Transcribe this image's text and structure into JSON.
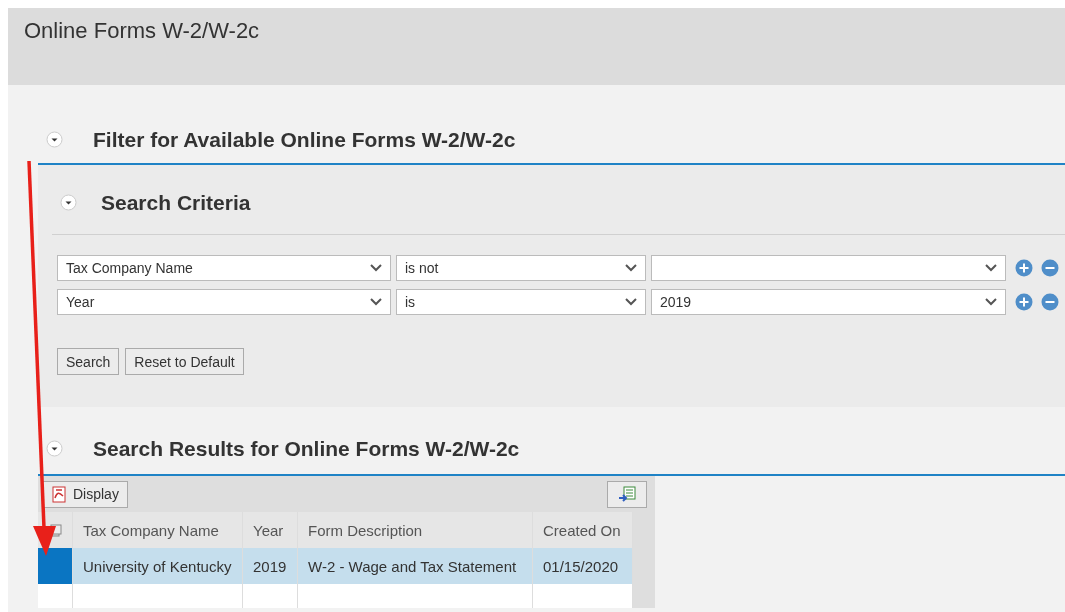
{
  "page": {
    "title": "Online Forms W-2/W-2c"
  },
  "filter_section": {
    "title": "Filter for Available Online Forms W-2/W-2c",
    "expanded": true
  },
  "search_criteria": {
    "title": "Search Criteria",
    "expanded": true,
    "rows": [
      {
        "field": "Tax Company Name",
        "operator": "is not",
        "value": ""
      },
      {
        "field": "Year",
        "operator": "is",
        "value": "2019"
      }
    ],
    "buttons": [
      "Search",
      "Reset to Default"
    ]
  },
  "results_section": {
    "title": "Search Results for Online Forms W-2/W-2c",
    "expanded": true,
    "toolbar": {
      "display_button": "Display"
    },
    "table": {
      "columns": [
        "Tax Company Name",
        "Year",
        "Form Description",
        "Created On"
      ],
      "rows": [
        {
          "selected": true,
          "cells": [
            "University of Kentucky",
            "2019",
            "W-2 - Wage and Tax Statement",
            "01/15/2020"
          ]
        }
      ]
    }
  },
  "annotation": {
    "kind": "arrow"
  }
}
